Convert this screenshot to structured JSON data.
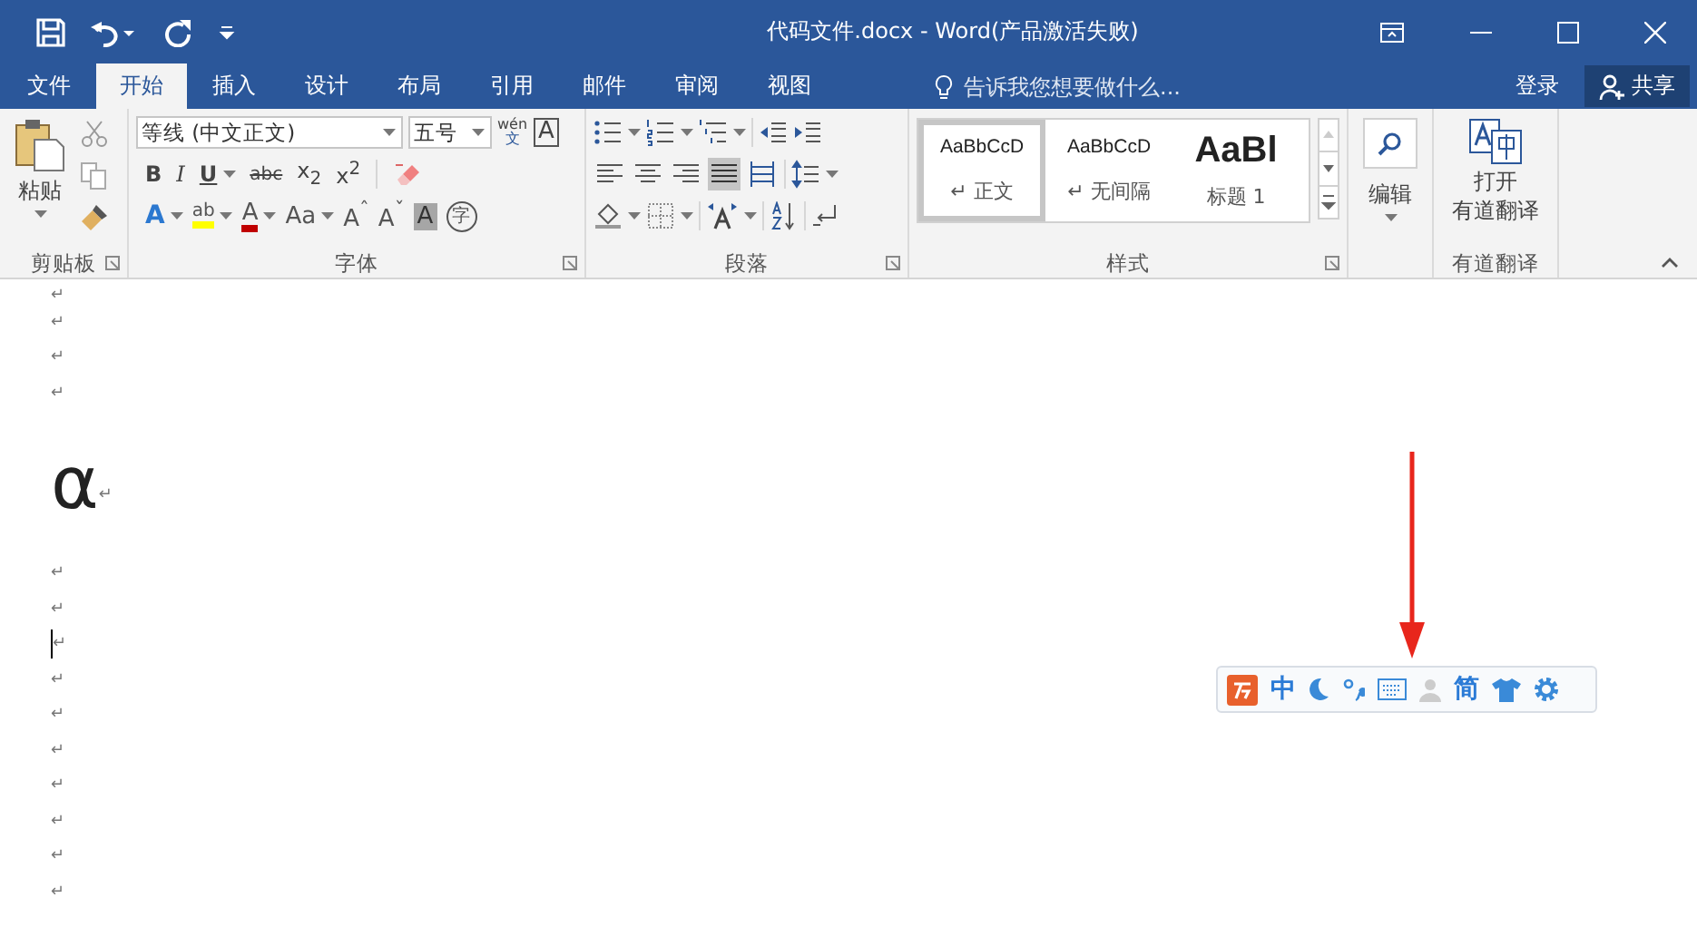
{
  "window": {
    "title": "代码文件.docx - Word(产品激活失败)"
  },
  "menu_tabs": [
    {
      "label": "文件",
      "selected": false
    },
    {
      "label": "开始",
      "selected": true
    },
    {
      "label": "插入",
      "selected": false
    },
    {
      "label": "设计",
      "selected": false
    },
    {
      "label": "布局",
      "selected": false
    },
    {
      "label": "引用",
      "selected": false
    },
    {
      "label": "邮件",
      "selected": false
    },
    {
      "label": "审阅",
      "selected": false
    },
    {
      "label": "视图",
      "selected": false
    }
  ],
  "tell_me": {
    "placeholder": "告诉我您想要做什么..."
  },
  "account": {
    "sign_in": "登录",
    "share": "共享"
  },
  "clipboard": {
    "paste": "粘贴",
    "label": "剪贴板"
  },
  "font": {
    "name": "等线 (中文正文)",
    "size": "五号",
    "phonetic_top": "wén",
    "phonetic_bottom": "文",
    "border_char": "A",
    "format_buttons": [
      {
        "text": "B",
        "kind": "bold",
        "dropdown": false
      },
      {
        "text": "I",
        "kind": "italic",
        "dropdown": false
      },
      {
        "text": "U",
        "kind": "underline",
        "dropdown": true
      },
      {
        "text": "abc",
        "kind": "strike",
        "dropdown": false
      },
      {
        "text": "x$_{2}$",
        "kind": "plain",
        "dropdown": false
      },
      {
        "text": "x$^{2}$",
        "kind": "plain",
        "dropdown": false
      }
    ],
    "effect_buttons": [
      {
        "text": "A",
        "kind": "outline",
        "dropdown": true
      },
      {
        "text": "ab",
        "kind": "highlight",
        "dropdown": true
      },
      {
        "text": "A",
        "kind": "color",
        "dropdown": true
      },
      {
        "text": "Aa",
        "kind": "plain",
        "dropdown": true
      },
      {
        "text": "A$^{ˆ}$",
        "kind": "plain",
        "dropdown": false
      },
      {
        "text": "A$^{ˇ}$",
        "kind": "plain",
        "dropdown": false
      },
      {
        "text": "A",
        "kind": "shade",
        "dropdown": false
      },
      {
        "text": "字",
        "kind": "circle",
        "dropdown": false
      }
    ],
    "label": "字体"
  },
  "paragraph": {
    "alignments": [
      {
        "kind": "left",
        "selected": false
      },
      {
        "kind": "center",
        "selected": false
      },
      {
        "kind": "right",
        "selected": false
      },
      {
        "kind": "justify",
        "selected": true
      },
      {
        "kind": "distribute",
        "selected": false
      }
    ],
    "label": "段落"
  },
  "styles": {
    "items": [
      {
        "preview": "AaBbCcD",
        "name": "↵ 正文",
        "kind": "normal",
        "selected": true
      },
      {
        "preview": "AaBbCcD",
        "name": "↵ 无间隔",
        "kind": "normal",
        "selected": false
      },
      {
        "preview": "AaBl",
        "name": "标题 1",
        "kind": "heading",
        "selected": false
      }
    ],
    "label": "样式"
  },
  "editing": {
    "label": "编辑"
  },
  "youdao": {
    "button_line1": "打开",
    "button_line2": "有道翻译",
    "label": "有道翻译"
  },
  "document": {
    "paragraphs": [
      {
        "kind": "empty",
        "mark": "↵",
        "cursor": false
      },
      {
        "kind": "empty",
        "mark": "↵",
        "cursor": false
      },
      {
        "kind": "empty",
        "mark": "↵",
        "cursor": false
      },
      {
        "kind": "empty",
        "mark": "↵",
        "cursor": false
      },
      {
        "kind": "symbol",
        "text": "α",
        "mark": "↵",
        "cursor": false
      },
      {
        "kind": "empty",
        "mark": "↵",
        "cursor": false
      },
      {
        "kind": "empty",
        "mark": "↵",
        "cursor": false
      },
      {
        "kind": "empty",
        "mark": "↵",
        "cursor": true
      },
      {
        "kind": "empty",
        "mark": "↵",
        "cursor": false
      },
      {
        "kind": "empty",
        "mark": "↵",
        "cursor": false
      },
      {
        "kind": "empty",
        "mark": "↵",
        "cursor": false
      },
      {
        "kind": "empty",
        "mark": "↵",
        "cursor": false
      },
      {
        "kind": "empty",
        "mark": "↵",
        "cursor": false
      },
      {
        "kind": "empty",
        "mark": "↵",
        "cursor": false
      },
      {
        "kind": "empty",
        "mark": "↵",
        "cursor": false
      }
    ]
  },
  "ime_toolbar": {
    "input_mode": "中",
    "script_mode": "简"
  }
}
